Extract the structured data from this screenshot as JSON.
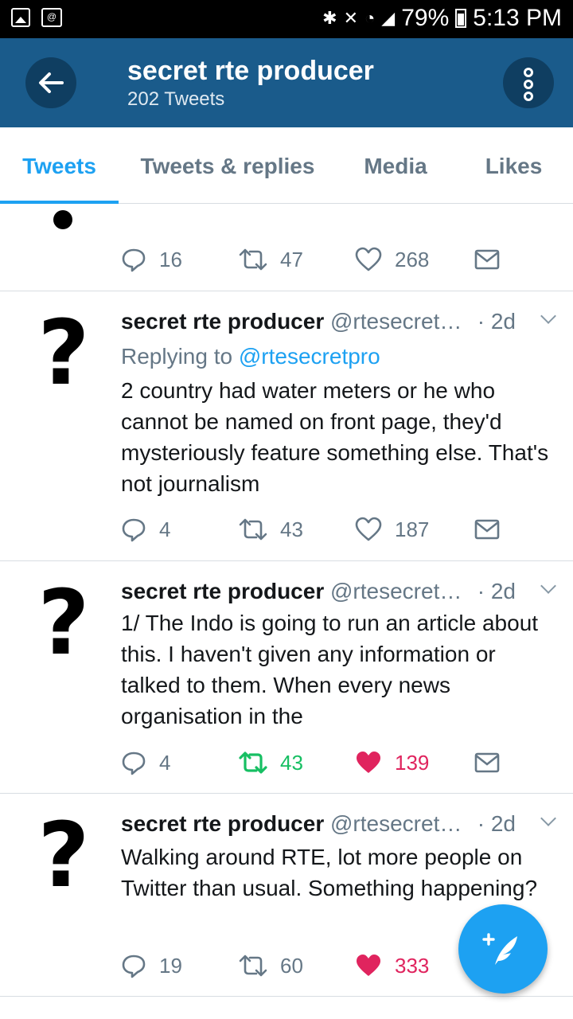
{
  "status_bar": {
    "battery": "79%",
    "time": "5:13 PM"
  },
  "header": {
    "title": "secret rte producer",
    "subtitle": "202 Tweets"
  },
  "tabs": [
    "Tweets",
    "Tweets & replies",
    "Media",
    "Likes"
  ],
  "partial_tweet": {
    "replies": "16",
    "retweets": "47",
    "likes": "268"
  },
  "tweets": [
    {
      "name": "secret rte producer",
      "handle": "@rtesecret…",
      "time": "· 2d",
      "replying_prefix": "Replying to",
      "replying_handle": "@rtesecretpro",
      "text": "2 country had water meters or he who cannot be named on front page, they'd mysteriously feature something else. That's not journalism",
      "replies": "4",
      "retweets": "43",
      "likes": "187"
    },
    {
      "name": "secret rte producer",
      "handle": "@rtesecret…",
      "time": "· 2d",
      "text": "1/ The Indo is going to run an article about this. I haven't given any information or talked to them. When every news organisation in the",
      "replies": "4",
      "retweets": "43",
      "likes": "139"
    },
    {
      "name": "secret rte producer",
      "handle": "@rtesecret…",
      "time": "· 2d",
      "text": "Walking around RTE, lot more people on Twitter than usual. Something happening?",
      "replies": "19",
      "retweets": "60",
      "likes": "333"
    }
  ],
  "colors": {
    "appbar": "#1a5b8b",
    "accent": "#1da1f2",
    "retweet_active": "#17bf63",
    "like_active": "#e0245e"
  }
}
